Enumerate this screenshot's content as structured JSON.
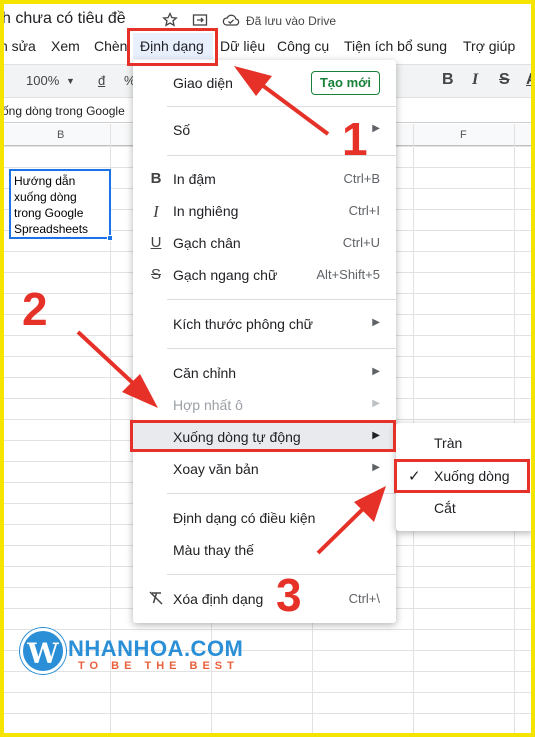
{
  "title_bar": {
    "doc_title": "h chưa có tiêu đề",
    "saved_status": "Đã lưu vào Drive"
  },
  "menubar": {
    "items": [
      "n sửa",
      "Xem",
      "Chèn",
      "Định dạng",
      "Dữ liệu",
      "Công cụ",
      "Tiện ích bổ sung",
      "Trợ giúp"
    ]
  },
  "toolbar": {
    "zoom": "100%",
    "currency": "đ",
    "percent": "%",
    "bold": "B",
    "italic": "I",
    "strike": "S",
    "text_color": "A"
  },
  "formula_bar": {
    "content": "ống dòng trong Google"
  },
  "columns": [
    "B",
    "F"
  ],
  "cell": {
    "text_lines": [
      "Hướng dẫn",
      "xuống dòng",
      "trong Google",
      "Spreadsheets"
    ]
  },
  "format_menu": {
    "theme": "Giao diện",
    "new_button": "Tạo mới",
    "number": "Số",
    "bold": "In đậm",
    "bold_shortcut": "Ctrl+B",
    "italic": "In nghiêng",
    "italic_shortcut": "Ctrl+I",
    "underline": "Gạch chân",
    "underline_shortcut": "Ctrl+U",
    "strikethrough": "Gạch ngang chữ",
    "strikethrough_shortcut": "Alt+Shift+5",
    "font_size": "Kích thước phông chữ",
    "alignment": "Căn chỉnh",
    "merge_cells": "Hợp nhất ô",
    "wrapping": "Xuống dòng tự động",
    "rotation": "Xoay văn bản",
    "conditional": "Định dạng có điều kiện",
    "alternating": "Màu thay thế",
    "clear": "Xóa định dạng",
    "clear_shortcut": "Ctrl+\\"
  },
  "wrap_submenu": {
    "overflow": "Tràn",
    "wrap": "Xuống dòng",
    "clip": "Cắt"
  },
  "annotations": {
    "step1": "1",
    "step2": "2",
    "step3": "3"
  },
  "logo": {
    "letter": "W",
    "name": "NHANHOA.COM",
    "tagline": "TO BE THE BEST"
  },
  "colors": {
    "annotation_red": "#e53127",
    "frame_yellow": "#f5e400",
    "selection_blue": "#1a73e8",
    "new_button_green": "#188038",
    "logo_blue": "#2a8fd6",
    "logo_orange": "#e8603c"
  }
}
